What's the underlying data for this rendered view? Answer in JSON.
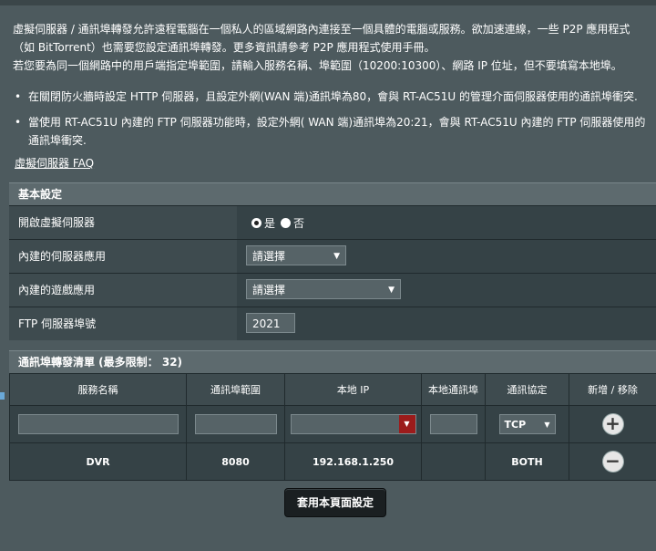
{
  "intro": {
    "line1": "虛擬伺服器 / 通訊埠轉發允許遠程電腦在一個私人的區域網路內連接至一個具體的電腦或服務。欲加速連線，一些 P2P 應用程式（如 BitTorrent）也需要您設定通訊埠轉發。更多資訊請參考 P2P 應用程式使用手冊。",
    "line2": "若您要為同一個網路中的用戶端指定埠範圍，請輸入服務名稱、埠範圍（10200:10300）、網路 IP 位址，但不要填寫本地埠。"
  },
  "bullets": [
    "在關閉防火牆時設定 HTTP 伺服器，且設定外網(WAN 端)通訊埠為80，會與 RT-AC51U 的管理介面伺服器使用的通訊埠衝突.",
    "當使用 RT-AC51U 內建的 FTP 伺服器功能時，設定外網( WAN 端)通訊埠為20:21，會與 RT-AC51U 內建的 FTP 伺服器使用的通訊埠衝突."
  ],
  "faq_link": "虛擬伺服器 FAQ",
  "basic": {
    "header": "基本設定",
    "enable_label": "開啟虛擬伺服器",
    "yes": "是",
    "no": "否",
    "server_app_label": "內建的伺服器應用",
    "server_app_value": "請選擇",
    "game_app_label": "內建的遊戲應用",
    "game_app_value": "請選擇",
    "ftp_port_label": "FTP 伺服器埠號",
    "ftp_port_value": "2021"
  },
  "list": {
    "header": "通訊埠轉發清單 (最多限制： 32)",
    "columns": [
      "服務名稱",
      "通訊埠範圍",
      "本地 IP",
      "本地通訊埠",
      "通訊協定",
      "新增 / 移除"
    ],
    "protocol_default": "TCP",
    "rows": [
      {
        "service": "DVR",
        "port_range": "8080",
        "local_ip": "192.168.1.250",
        "local_port": "",
        "protocol": "BOTH"
      }
    ]
  },
  "apply_button": "套用本頁面設定",
  "colors": {
    "background": "#4d5a5e",
    "header": "#5d6a6e",
    "accent_red": "#9c1b1b"
  }
}
